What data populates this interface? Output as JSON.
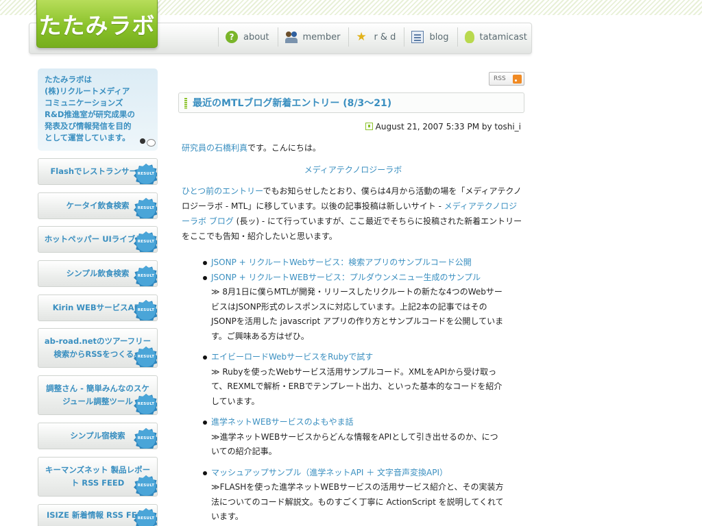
{
  "header": {
    "logo": "たたみラボ",
    "nav": [
      "about",
      "member",
      "r & d",
      "blog",
      "tatamicast"
    ]
  },
  "sidebar": {
    "intro": "たたみラボは\n(株)リクルートメディア\nコミュニケーションズ\nR&D推進室が研究成果の\n発表及び情報発信を目的\nとして運営しています。",
    "badge": "RESULT",
    "items": [
      "Flashでレストランサーチ",
      "ケータイ飲食検索",
      "ホットペッパー UIライブラリ",
      "シンプル飲食検索",
      "Kirin WEBサービスAPI",
      "ab-road.netのツアーフリー検索からRSSをつくる。",
      "調整さん - 簡単みんなのスケジュール調整ツール",
      "シンプル宿検索",
      "キーマンズネット 製品レポート RSS FEED",
      "ISIZE 新着情報 RSS FEED"
    ]
  },
  "rss_label": "RSS",
  "post": {
    "title": "最近のMTLブログ新着エントリー (8/3〜21)",
    "meta": "August 21, 2007 5:33 PM by toshi_i",
    "greeting_link": "研究員の石橋利真",
    "greeting_rest": "です。こんにちは。",
    "center_link": "メディアテクノロジーラボ",
    "p1_link1": "ひとつ前のエントリー",
    "p1_text1": "でもお知らせしたとおり、僕らは4月から活動の場を「メディアテクノロジーラボ - MTL」に移しています。以後の記事投稿は新しいサイト - ",
    "p1_link2": "メディアテクノロジーラボ ブログ",
    "p1_text2": " (長ッ) - にて行っていますが、ここ最近でそちらに投稿された新着エントリーをここでも告知・紹介したいと思います。",
    "entries": [
      {
        "title": "JSONP + リクルートWebサービス：検索アプリのサンプルコード公開",
        "desc": ""
      },
      {
        "title": "JSONP + リクルートWEBサービス：プルダウンメニュー生成のサンプル",
        "desc": "≫ 8月1日に僕らMTLが開発・リリースしたリクルートの新たな4つのWebサービスはJSONP形式のレスポンスに対応しています。上記2本の記事ではそのJSONPを活用した javascript アプリの作り方とサンプルコードを公開しています。ご興味ある方はぜひ。"
      },
      {
        "title": "エイビーロードWebサービスをRubyで試す",
        "desc": "≫ Rubyを使ったWebサービス活用サンプルコード。XMLをAPIから受け取って、REXMLで解析・ERBでテンプレート出力、といった基本的なコードを紹介しています。"
      },
      {
        "title": "進学ネットWEBサービスのよもやま話",
        "desc": "≫進学ネットWEBサービスからどんな情報をAPIとして引き出せるのか、についての紹介記事。"
      },
      {
        "title": "マッシュアップサンプル（進学ネットAPI ＋ 文字音声変換API）",
        "desc": "≫FLASHを使った進学ネットWEBサービスの活用サービス紹介と、その実装方法についてのコード解説文。ものすごく丁寧に ActionScript を説明してくれています。"
      }
    ]
  }
}
